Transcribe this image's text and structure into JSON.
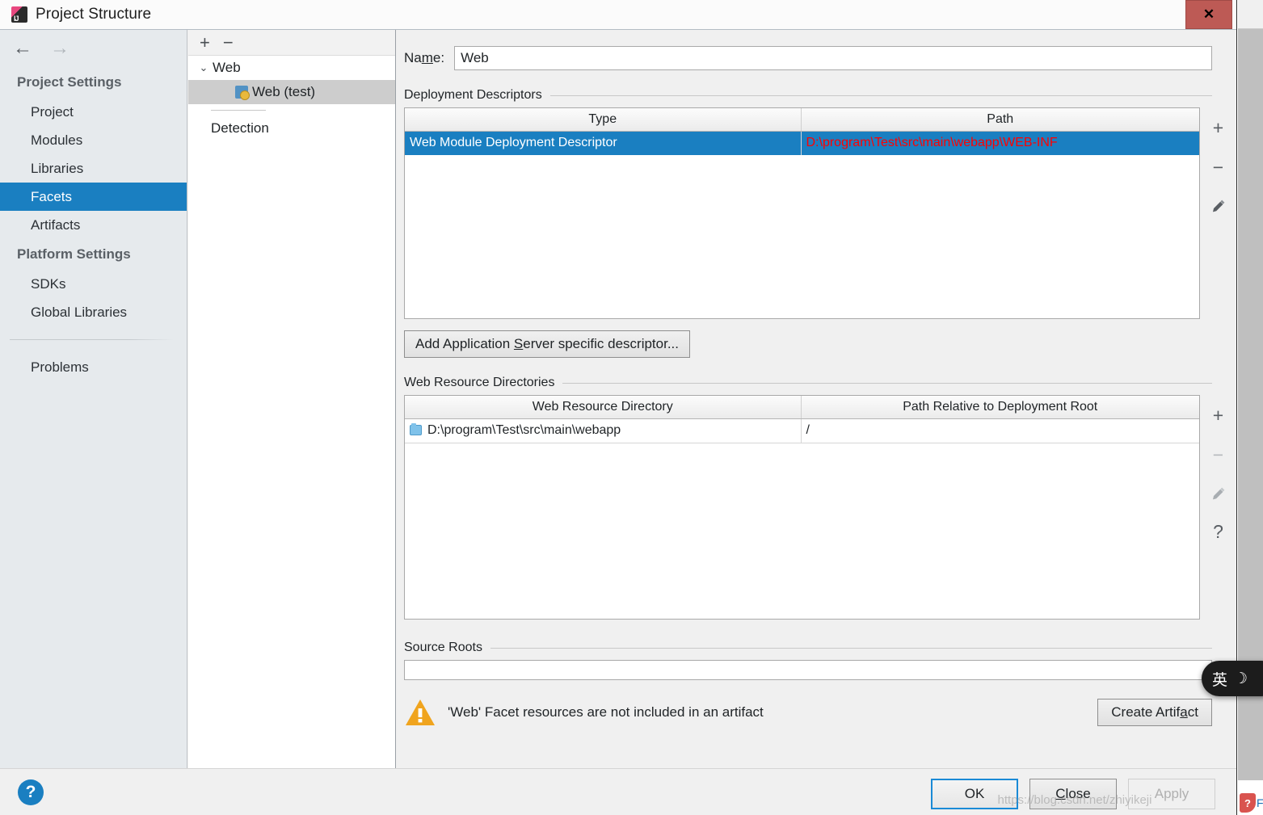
{
  "window": {
    "title": "Project Structure",
    "app_icon": "intellij-idea-icon",
    "close_label": "✕"
  },
  "sidebar": {
    "back_icon": "←",
    "forward_icon": "→",
    "groups": [
      {
        "title": "Project Settings",
        "items": [
          {
            "label": "Project",
            "selected": false
          },
          {
            "label": "Modules",
            "selected": false
          },
          {
            "label": "Libraries",
            "selected": false
          },
          {
            "label": "Facets",
            "selected": true
          },
          {
            "label": "Artifacts",
            "selected": false
          }
        ]
      },
      {
        "title": "Platform Settings",
        "items": [
          {
            "label": "SDKs",
            "selected": false
          },
          {
            "label": "Global Libraries",
            "selected": false
          }
        ]
      }
    ],
    "extra_items": [
      {
        "label": "Problems",
        "selected": false
      }
    ]
  },
  "tree": {
    "toolbar": {
      "add": "+",
      "remove": "−"
    },
    "nodes": [
      {
        "label": "Web",
        "level": 0,
        "expanded": true,
        "chevron": "⌄",
        "selected": false
      },
      {
        "label": "Web (test)",
        "level": 1,
        "icon": "web-facet-icon",
        "selected": true
      },
      {
        "label": "Detection",
        "level": 0,
        "selected": false
      }
    ]
  },
  "content": {
    "name_field": {
      "label_pre": "Na",
      "label_mnemonic": "m",
      "label_post": "e:",
      "value": "Web",
      "placeholder": ""
    },
    "deployment_descriptors": {
      "section_title": "Deployment Descriptors",
      "columns": [
        "Type",
        "Path"
      ],
      "rows": [
        {
          "type": "Web Module Deployment Descriptor",
          "path": "D:\\program\\Test\\src\\main\\webapp\\WEB-INF",
          "selected": true,
          "path_color": "#ff0000"
        }
      ],
      "actions": [
        {
          "name": "add-descriptor-button",
          "glyph": "+",
          "enabled": true
        },
        {
          "name": "remove-descriptor-button",
          "glyph": "−",
          "enabled": true
        },
        {
          "name": "edit-descriptor-button",
          "glyph": "pencil",
          "enabled": true
        }
      ],
      "add_button": {
        "pre": "Add Application ",
        "mnemonic": "S",
        "post": "erver specific descriptor..."
      }
    },
    "web_resource_directories": {
      "section_title": "Web Resource Directories",
      "columns": [
        "Web Resource Directory",
        "Path Relative to Deployment Root"
      ],
      "rows": [
        {
          "directory": "D:\\program\\Test\\src\\main\\webapp",
          "relative_path": "/",
          "icon": "folder-icon"
        }
      ],
      "actions": [
        {
          "name": "add-resource-dir-button",
          "glyph": "+",
          "enabled": true
        },
        {
          "name": "remove-resource-dir-button",
          "glyph": "−",
          "enabled": false
        },
        {
          "name": "edit-resource-dir-button",
          "glyph": "pencil",
          "enabled": false
        },
        {
          "name": "help-resource-dir-button",
          "glyph": "?",
          "enabled": true
        }
      ]
    },
    "source_roots": {
      "section_title": "Source Roots",
      "value": ""
    },
    "warning": {
      "icon": "warning-triangle-icon",
      "text": "'Web' Facet resources are not included in an artifact",
      "action_button": {
        "pre": "Create Artif",
        "mnemonic": "a",
        "post": "ct"
      }
    }
  },
  "footer": {
    "help_glyph": "?",
    "buttons": [
      {
        "name": "ok-button",
        "label": "OK",
        "default": true,
        "enabled": true
      },
      {
        "name": "close-button",
        "pre": "",
        "mnemonic": "C",
        "post": "lose",
        "label": "Close",
        "enabled": true
      },
      {
        "name": "apply-button",
        "label": "Apply",
        "enabled": false
      }
    ]
  },
  "overlay": {
    "ime_indicator": {
      "mode": "英",
      "moon": "☽"
    },
    "watermark": "https://blog.csdn.net/zhiyikeji",
    "tray_badge": "?",
    "tray_label": "Fv"
  },
  "colors": {
    "accent_selection": "#1a7fc1",
    "path_red": "#ff0000",
    "warning_orange": "#f0a41e",
    "close_red": "#bd5a55"
  }
}
